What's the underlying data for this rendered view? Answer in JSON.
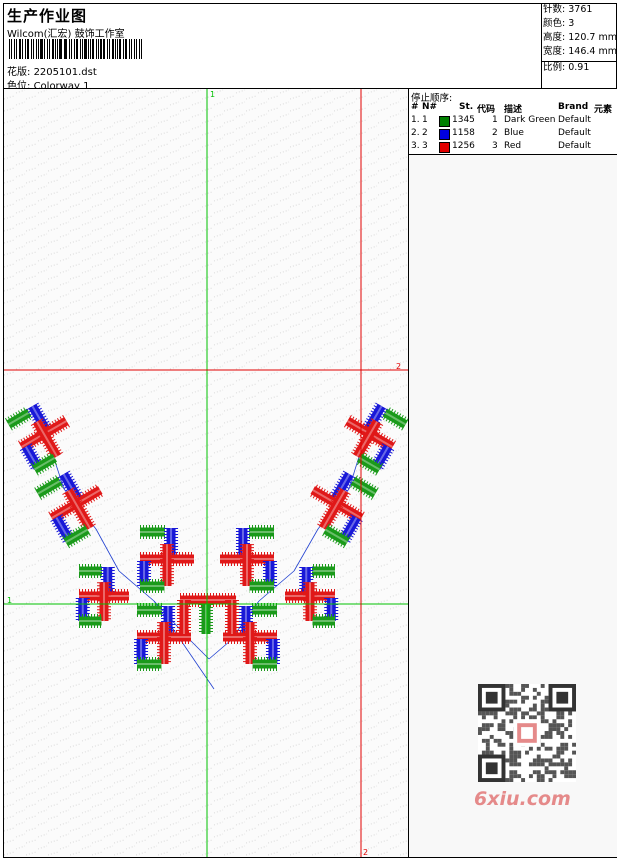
{
  "header": {
    "title": "生产作业图",
    "company": "Wilcom(汇宏) 鼓饰工作室",
    "design_label": "花版:",
    "design_value": "2205101.dst",
    "colorway_label": "色位:",
    "colorway_value": "Colorway 1"
  },
  "stats": {
    "stitches_label": "针数:",
    "stitches_value": "3761",
    "colors_label": "颜色:",
    "colors_value": "3",
    "height_label": "高度:",
    "height_value": "120.7 mm",
    "width_label": "宽度:",
    "width_value": "146.4 mm",
    "scale_label": "比例:",
    "scale_value": "0.91"
  },
  "guides": {
    "green_top": "1",
    "red_right": "2",
    "green_left": "1",
    "red_bottom": "2",
    "green_color": "#00c000",
    "red_color": "#e00000"
  },
  "stop_sequence": {
    "title": "停止顺序:",
    "headers": {
      "hash": "#",
      "no": "N#",
      "st": "St.",
      "code": "代码",
      "desc": "描述",
      "brand": "Brand",
      "element": "元素"
    },
    "rows": [
      {
        "hash": "1.",
        "no": "1",
        "color": "#008000",
        "st": "1345",
        "code": "1",
        "desc": "Dark Green",
        "brand": "Default"
      },
      {
        "hash": "2.",
        "no": "2",
        "color": "#0000e0",
        "st": "1158",
        "code": "2",
        "desc": "Blue",
        "brand": "Default"
      },
      {
        "hash": "3.",
        "no": "3",
        "color": "#e00000",
        "st": "1256",
        "code": "3",
        "desc": "Red",
        "brand": "Default"
      }
    ]
  },
  "watermark": {
    "text": "6xiu.com",
    "icon": "qr-code-icon",
    "color": "#e58a8a"
  },
  "embroidery_colors": {
    "green": "#1a9a1a",
    "blue": "#1818d8",
    "red": "#e01818"
  }
}
